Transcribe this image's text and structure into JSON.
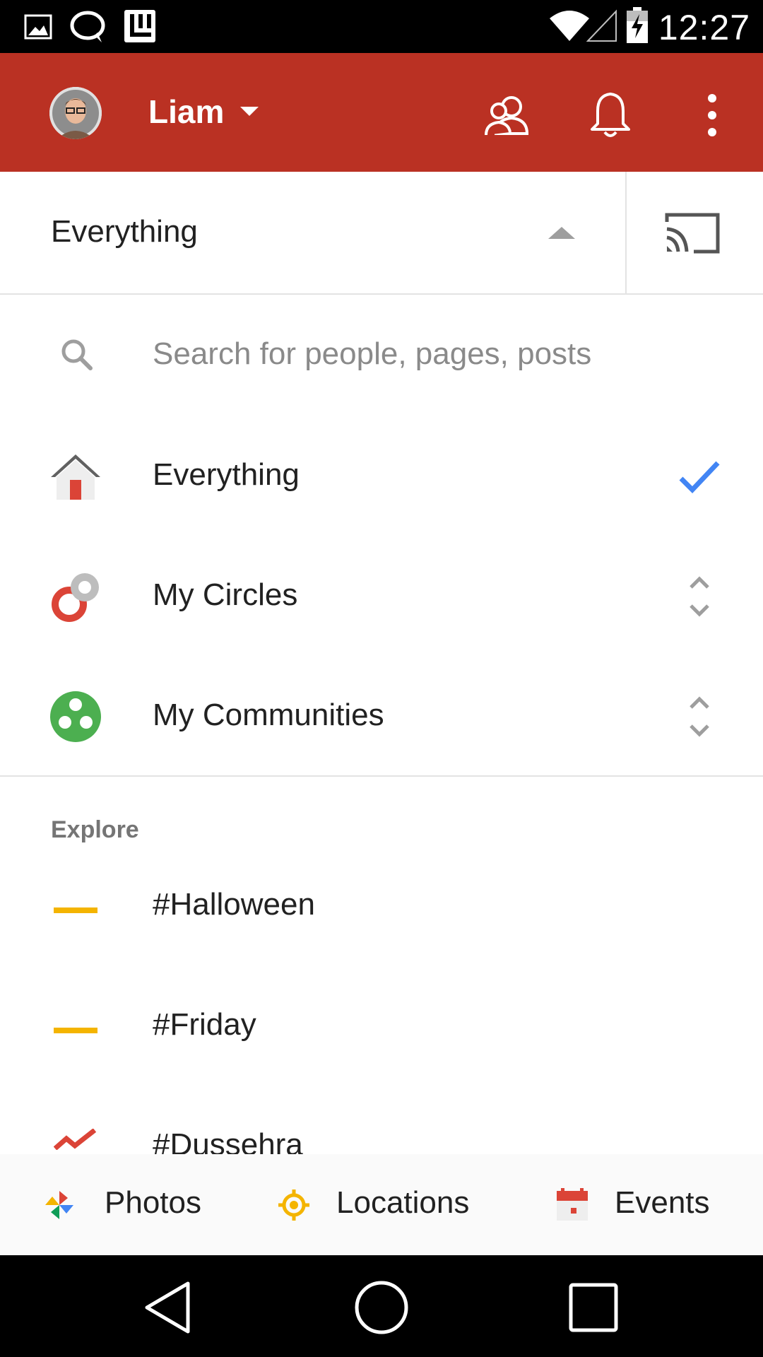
{
  "status_bar": {
    "time": "12:27",
    "icons": [
      "image-icon",
      "chat-bubble-icon",
      "app-icon",
      "wifi-icon",
      "cell-signal-icon",
      "battery-charging-icon"
    ]
  },
  "app_bar": {
    "account_name": "Liam",
    "brand_color": "#ba3123",
    "actions": [
      "people-icon",
      "notifications-bell-icon",
      "overflow-menu-icon"
    ]
  },
  "stream_selector": {
    "label": "Everything"
  },
  "search": {
    "placeholder": "Search for people, pages, posts",
    "value": ""
  },
  "streams": [
    {
      "label": "Everything",
      "icon": "home-icon",
      "trailing": "checkmark-icon",
      "selected": true
    },
    {
      "label": "My Circles",
      "icon": "circles-icon",
      "trailing": "expand-icon",
      "selected": false
    },
    {
      "label": "My Communities",
      "icon": "communities-icon",
      "trailing": "expand-icon",
      "selected": false
    }
  ],
  "explore": {
    "heading": "Explore",
    "items": [
      {
        "label": "#Halloween",
        "icon": "flat-trend-icon"
      },
      {
        "label": "#Friday",
        "icon": "flat-trend-icon"
      },
      {
        "label": "#Dussehra",
        "icon": "trending-icon"
      }
    ]
  },
  "bottom_actions": [
    {
      "label": "Photos",
      "icon": "photos-pinwheel-icon"
    },
    {
      "label": "Locations",
      "icon": "location-target-icon"
    },
    {
      "label": "Events",
      "icon": "calendar-icon"
    }
  ],
  "colors": {
    "accent_blue": "#4285f4",
    "trend_yellow": "#f4b400",
    "trend_red": "#db4437",
    "community_green": "#4caf50"
  }
}
